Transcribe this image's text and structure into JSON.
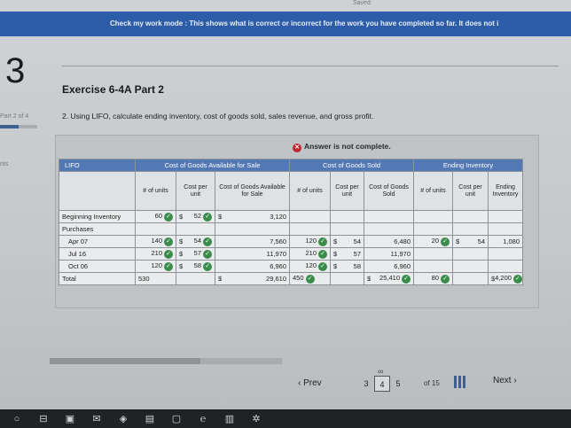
{
  "header": {
    "saved": "Saved",
    "banner": "Check my work mode : This shows what is correct or incorrect for the work you have completed so far. It does not i"
  },
  "question": {
    "number": "3",
    "exercise": "Exercise 6-4A Part 2",
    "part": "Part 2 of 4",
    "part_progress": 0.5,
    "side_label": "nts",
    "prompt": "2. Using LIFO, calculate ending inventory, cost of goods sold, sales revenue, and gross profit."
  },
  "status": {
    "text": "Answer is not complete.",
    "icon": "x-icon"
  },
  "table": {
    "method": "LIFO",
    "groups": [
      "Cost of Goods Available for Sale",
      "Cost of Goods Sold",
      "Ending Inventory"
    ],
    "sub": {
      "units": "# of units",
      "cost": "Cost per unit",
      "cogas": "Cost of Goods Available for Sale",
      "cogs": "Cost of Goods Sold",
      "ending": "Ending Inventory"
    },
    "rows": {
      "beginning": {
        "label": "Beginning Inventory",
        "units": "60",
        "cost": "52",
        "total": "3,120"
      },
      "purchases": {
        "label": "Purchases"
      },
      "apr": {
        "label": "Apr 07",
        "units": "140",
        "cost": "54",
        "total": "7,560",
        "s_units": "120",
        "s_cost": "54",
        "s_total": "6,480",
        "e_units": "20",
        "e_cost": "54",
        "e_total": "1,080"
      },
      "jul": {
        "label": "Jul 16",
        "units": "210",
        "cost": "57",
        "total": "11,970",
        "s_units": "210",
        "s_cost": "57",
        "s_total": "11,970"
      },
      "oct": {
        "label": "Oct 06",
        "units": "120",
        "cost": "58",
        "total": "6,960",
        "s_units": "120",
        "s_cost": "58",
        "s_total": "6,960"
      },
      "total": {
        "label": "Total",
        "units": "530",
        "total": "29,610",
        "s_units": "450",
        "s_total": "25,410",
        "e_units": "80",
        "e_total": "4,200"
      }
    },
    "dollar": "$"
  },
  "nav": {
    "prev": "Prev",
    "pages": [
      "3",
      "4",
      "5"
    ],
    "current_page": "4",
    "of": "of 15",
    "next": "Next"
  },
  "colors": {
    "banner": "#2d5da8",
    "header": "#5278b5",
    "check": "#3a8c4a",
    "error": "#c2262e"
  }
}
